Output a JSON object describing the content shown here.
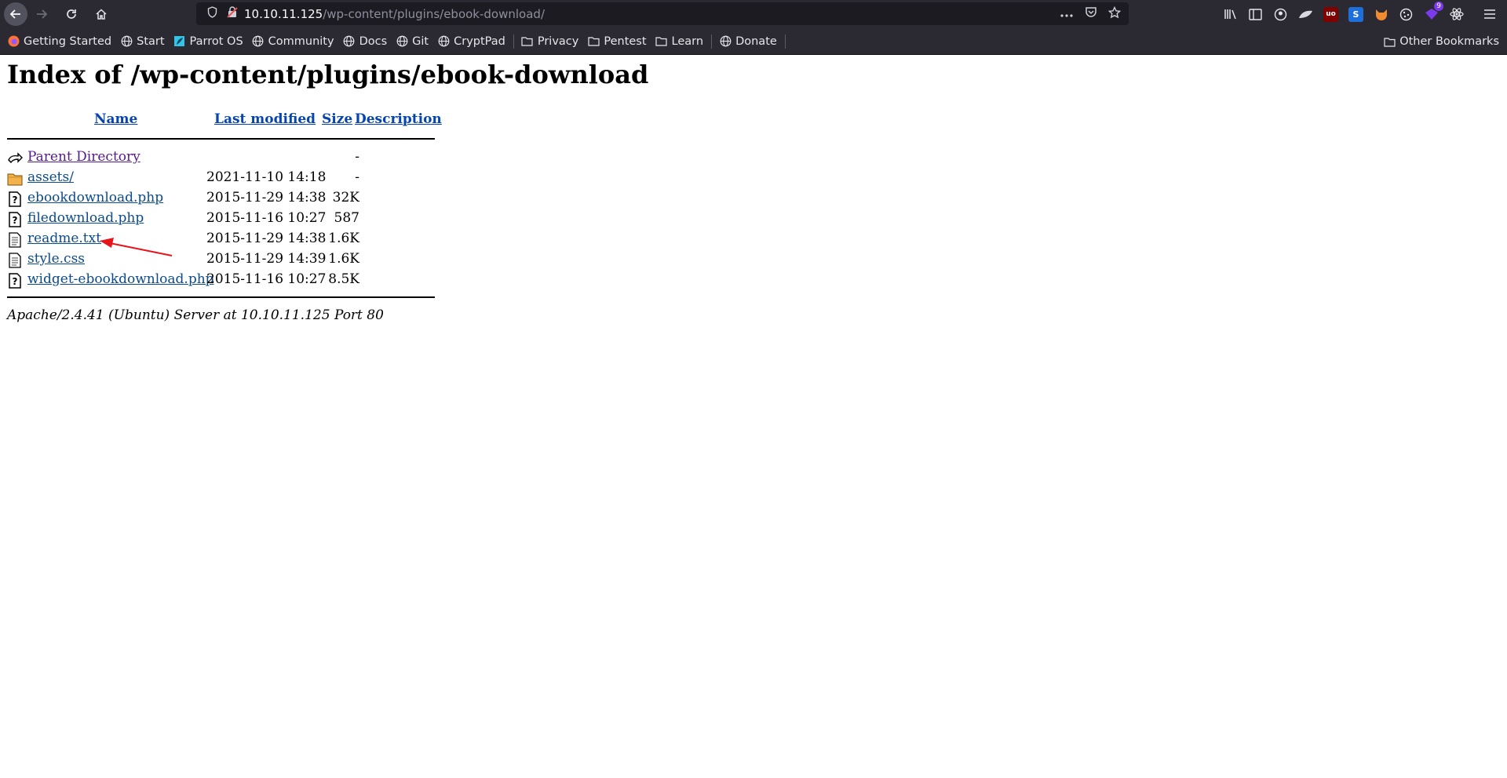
{
  "browser": {
    "url_host": "10.10.11.125",
    "url_path": "/wp-content/plugins/ebook-download/",
    "extension_badge": "9",
    "bookmarks": [
      {
        "label": "Getting Started",
        "icon": "firefox-icon"
      },
      {
        "label": "Start",
        "icon": "globe-icon"
      },
      {
        "label": "Parrot OS",
        "icon": "parrot-icon"
      },
      {
        "label": "Community",
        "icon": "globe-icon"
      },
      {
        "label": "Docs",
        "icon": "globe-icon"
      },
      {
        "label": "Git",
        "icon": "globe-icon"
      },
      {
        "label": "CryptPad",
        "icon": "globe-icon"
      },
      {
        "label": "Privacy",
        "icon": "folder-icon"
      },
      {
        "label": "Pentest",
        "icon": "folder-icon"
      },
      {
        "label": "Learn",
        "icon": "folder-icon"
      },
      {
        "label": "Donate",
        "icon": "globe-icon"
      }
    ],
    "other_bookmarks": "Other Bookmarks"
  },
  "page": {
    "title": "Index of /wp-content/plugins/ebook-download",
    "columns": {
      "name": "Name",
      "last_modified": "Last modified",
      "size": "Size",
      "description": "Description"
    },
    "rows": [
      {
        "name": "Parent Directory",
        "date": "",
        "size": "-",
        "icon": "back-icon",
        "visited": true
      },
      {
        "name": "assets/",
        "date": "2021-11-10 14:18",
        "size": "-",
        "icon": "folder-icon"
      },
      {
        "name": "ebookdownload.php",
        "date": "2015-11-29 14:38",
        "size": "32K",
        "icon": "unknown-file-icon"
      },
      {
        "name": "filedownload.php",
        "date": "2015-11-16 10:27",
        "size": "587",
        "icon": "unknown-file-icon"
      },
      {
        "name": "readme.txt",
        "date": "2015-11-29 14:38",
        "size": "1.6K",
        "icon": "text-file-icon"
      },
      {
        "name": "style.css",
        "date": "2015-11-29 14:39",
        "size": "1.6K",
        "icon": "text-file-icon"
      },
      {
        "name": "widget-ebookdownload.php",
        "date": "2015-11-16 10:27",
        "size": "8.5K",
        "icon": "unknown-file-icon"
      }
    ],
    "footer": "Apache/2.4.41 (Ubuntu) Server at 10.10.11.125 Port 80"
  },
  "annotation": {
    "color": "#e8141c",
    "target": "readme.txt"
  }
}
